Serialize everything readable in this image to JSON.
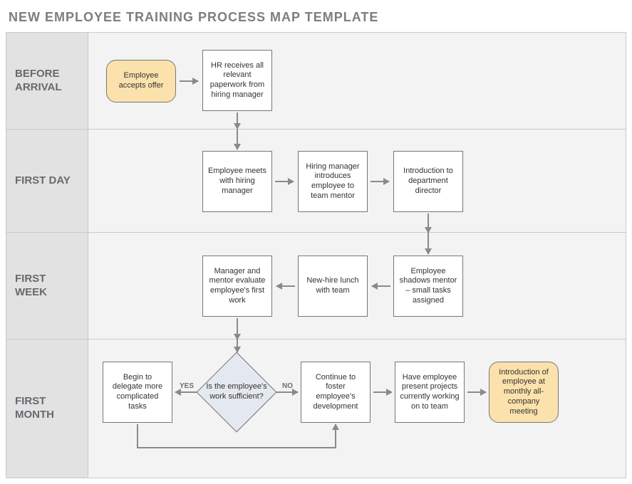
{
  "title": "NEW EMPLOYEE TRAINING PROCESS MAP TEMPLATE",
  "lanes": {
    "before": {
      "label": "BEFORE ARRIVAL"
    },
    "day": {
      "label": "FIRST DAY"
    },
    "week": {
      "label": "FIRST WEEK"
    },
    "month": {
      "label": "FIRST MONTH"
    }
  },
  "nodes": {
    "accepts": "Employee accepts offer",
    "hr": "HR receives all relevant paperwork from hiring manager",
    "meets": "Employee meets with hiring manager",
    "mentor": "Hiring manager introduces employee to team mentor",
    "director": "Introduction to department director",
    "shadows": "Employee shadows mentor – small tasks assigned",
    "lunch": "New-hire lunch with team",
    "evaluate": "Manager and mentor evaluate employee's first work",
    "decision": "Is the employee's work sufficient?",
    "delegate": "Begin to delegate more complicated tasks",
    "foster": "Continue to foster employee's development",
    "present": "Have employee present projects currently working on to team",
    "intro": "Introduction of employee at monthly all-company meeting"
  },
  "edgeLabels": {
    "yes": "YES",
    "no": "NO"
  },
  "colors": {
    "laneLabel": "#e2e2e3",
    "lane": "#f3f3f4",
    "yellow": "#fbe2ac",
    "diamond": "#e4e8ef"
  }
}
